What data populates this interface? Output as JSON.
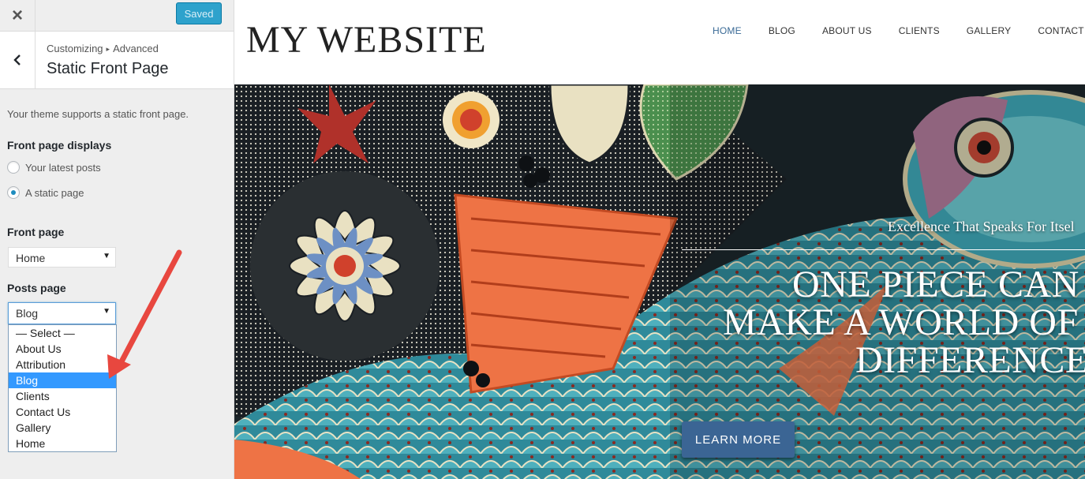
{
  "customizer": {
    "close_icon": "×",
    "saved_label": "Saved",
    "back_icon": "chevron-left-icon",
    "breadcrumb_parent": "Customizing",
    "breadcrumb_sep": "▸",
    "breadcrumb_child": "Advanced",
    "section_title": "Static Front Page",
    "description": "Your theme supports a static front page.",
    "front_page_displays": {
      "heading": "Front page displays",
      "options": [
        {
          "label": "Your latest posts",
          "checked": false
        },
        {
          "label": "A static page",
          "checked": true
        }
      ]
    },
    "front_page": {
      "heading": "Front page",
      "value": "Home"
    },
    "posts_page": {
      "heading": "Posts page",
      "value": "Blog",
      "options": [
        "— Select —",
        "About Us",
        "Attribution",
        "Blog",
        "Clients",
        "Contact Us",
        "Gallery",
        "Home"
      ],
      "highlighted": "Blog"
    }
  },
  "preview": {
    "site_title": "MY WEBSITE",
    "nav": [
      "HOME",
      "BLOG",
      "ABOUT US",
      "CLIENTS",
      "GALLERY",
      "CONTACT US"
    ],
    "hero": {
      "tagline": "Excellence That Speaks For Itsel",
      "headline": [
        "ONE PIECE CAN",
        "MAKE A WORLD OF",
        "DIFFERENCE"
      ],
      "button": "LEARN MORE"
    }
  },
  "colors": {
    "accent": "#2ea2cc",
    "nav_active": "#3a6a96",
    "button": "#3b6594",
    "highlight": "#3399ff",
    "annotation_arrow": "#e8473f"
  }
}
